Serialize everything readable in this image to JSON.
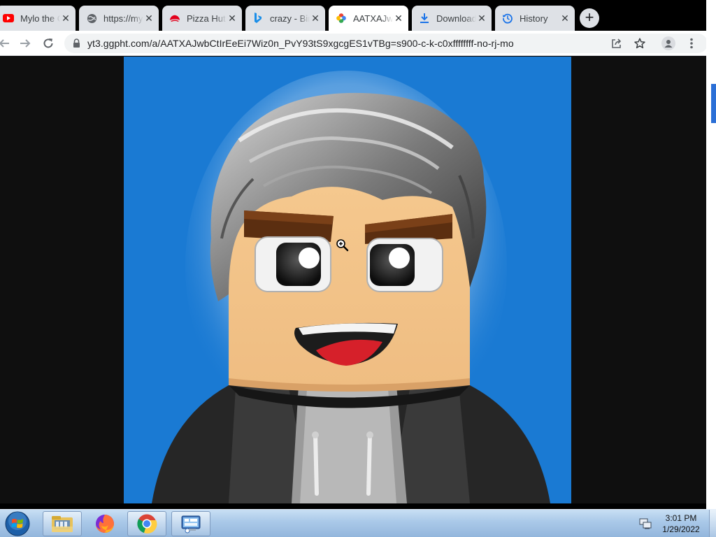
{
  "browser": {
    "tabs": [
      {
        "title": "Mylo the C",
        "icon": "youtube-icon"
      },
      {
        "title": "https://my",
        "icon": "globe-icon"
      },
      {
        "title": "Pizza Hut",
        "icon": "pizza-hut-icon"
      },
      {
        "title": "crazy - Bing",
        "icon": "bing-icon"
      },
      {
        "title": "AATXAJwb",
        "icon": "google-photos-icon",
        "active": true
      },
      {
        "title": "Downloads",
        "icon": "download-icon"
      },
      {
        "title": "History",
        "icon": "history-icon"
      }
    ],
    "tab_close_glyph": "✕",
    "new_tab_glyph": "+",
    "url": "yt3.ggpht.com/a/AATXAJwbCtIrEeEi7Wiz0n_PvY93tS9xgcgES1vTBg=s900-c-k-c0xffffffff-no-rj-mo"
  },
  "page": {
    "image_subject": "avatar-image",
    "background_color": "#1a7ad3"
  },
  "taskbar": {
    "apps": [
      "windows-explorer-icon",
      "firefox-icon",
      "chrome-icon",
      "remote-desktop-icon"
    ],
    "time": "3:01 PM",
    "date": "1/29/2022"
  }
}
